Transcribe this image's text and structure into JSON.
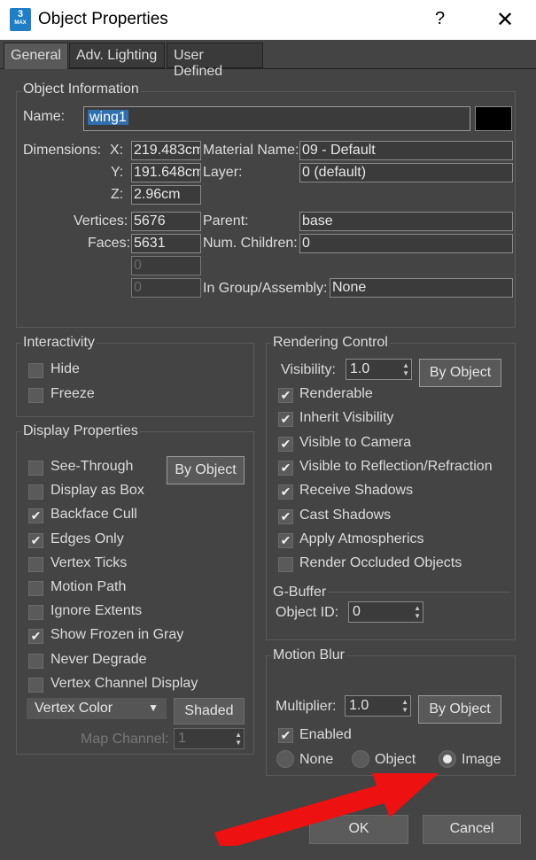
{
  "window": {
    "title": "Object Properties",
    "help": "?",
    "close": "✕",
    "app_icon_num": "3",
    "app_icon_text": "MAX"
  },
  "tabs": [
    "General",
    "Adv. Lighting",
    "User Defined"
  ],
  "object_info": {
    "title": "Object Information",
    "name_label": "Name:",
    "name_value": "wing1",
    "color_swatch": "#000000",
    "dimensions_label": "Dimensions:",
    "x_label": "X:",
    "x_value": "219.483cm",
    "y_label": "Y:",
    "y_value": "191.648cm",
    "z_label": "Z:",
    "z_value": "2.96cm",
    "vertices_label": "Vertices:",
    "vertices_value": "5676",
    "faces_label": "Faces:",
    "faces_value": "5631",
    "extra1": "0",
    "extra2": "0",
    "material_label": "Material Name:",
    "material_value": "09 - Default",
    "layer_label": "Layer:",
    "layer_value": "0 (default)",
    "parent_label": "Parent:",
    "parent_value": "base",
    "children_label": "Num. Children:",
    "children_value": "0",
    "group_label": "In Group/Assembly:",
    "group_value": "None"
  },
  "interactivity": {
    "title": "Interactivity",
    "items": [
      {
        "label": "Hide",
        "checked": false
      },
      {
        "label": "Freeze",
        "checked": false
      }
    ]
  },
  "display": {
    "title": "Display Properties",
    "by_object": "By Object",
    "items": [
      {
        "label": "See-Through",
        "checked": false
      },
      {
        "label": "Display as Box",
        "checked": false
      },
      {
        "label": "Backface Cull",
        "checked": true
      },
      {
        "label": "Edges Only",
        "checked": true
      },
      {
        "label": "Vertex Ticks",
        "checked": false
      },
      {
        "label": "Motion Path",
        "checked": false
      },
      {
        "label": "Ignore Extents",
        "checked": false
      },
      {
        "label": "Show Frozen in Gray",
        "checked": true
      },
      {
        "label": "Never Degrade",
        "checked": false
      },
      {
        "label": "Vertex Channel Display",
        "checked": false
      }
    ],
    "vertex_color": "Vertex Color",
    "shaded": "Shaded",
    "map_channel_label": "Map Channel:",
    "map_channel_value": "1"
  },
  "rendering": {
    "title": "Rendering Control",
    "visibility_label": "Visibility:",
    "visibility_value": "1.0",
    "by_object": "By Object",
    "items": [
      {
        "label": "Renderable",
        "checked": true
      },
      {
        "label": "Inherit Visibility",
        "checked": true
      },
      {
        "label": "Visible to Camera",
        "checked": true
      },
      {
        "label": "Visible to Reflection/Refraction",
        "checked": true
      },
      {
        "label": "Receive Shadows",
        "checked": true
      },
      {
        "label": "Cast Shadows",
        "checked": true
      },
      {
        "label": "Apply Atmospherics",
        "checked": true
      },
      {
        "label": "Render Occluded Objects",
        "checked": false
      }
    ],
    "gbuffer_title": "G-Buffer",
    "object_id_label": "Object ID:",
    "object_id_value": "0"
  },
  "motion_blur": {
    "title": "Motion Blur",
    "multiplier_label": "Multiplier:",
    "multiplier_value": "1.0",
    "by_object": "By Object",
    "enabled_label": "Enabled",
    "enabled_checked": true,
    "radio_none": "None",
    "radio_object": "Object",
    "radio_image": "Image",
    "selected": "Image"
  },
  "footer": {
    "ok": "OK",
    "cancel": "Cancel"
  },
  "annotation_color": "#ee1111"
}
